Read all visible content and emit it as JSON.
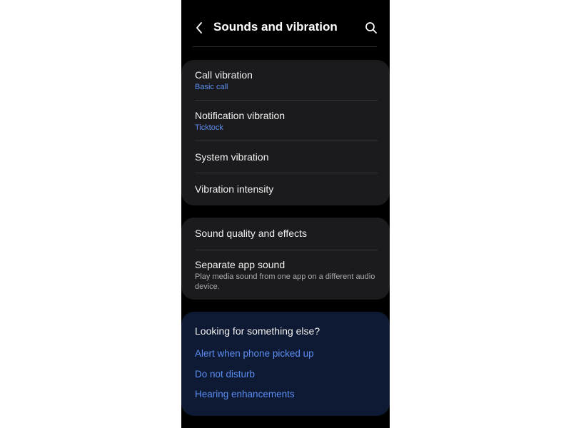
{
  "header": {
    "title": "Sounds and vibration"
  },
  "vibration_section": {
    "items": [
      {
        "title": "Call vibration",
        "subtitle": "Basic call"
      },
      {
        "title": "Notification vibration",
        "subtitle": "Ticktock"
      },
      {
        "title": "System vibration"
      },
      {
        "title": "Vibration intensity"
      }
    ]
  },
  "sound_section": {
    "items": [
      {
        "title": "Sound quality and effects"
      },
      {
        "title": "Separate app sound",
        "description": "Play media sound from one app on a different audio device."
      }
    ]
  },
  "suggestions": {
    "title": "Looking for something else?",
    "links": [
      "Alert when phone picked up",
      "Do not disturb",
      "Hearing enhancements"
    ]
  },
  "colors": {
    "background": "#000000",
    "card": "#1b1b1e",
    "suggestion_card": "#0e1a33",
    "accent": "#5c8df0",
    "text_primary": "#f2f2f2",
    "text_secondary": "#a9a9ae"
  },
  "icons": {
    "back": "chevron-left-icon",
    "search": "search-icon"
  }
}
